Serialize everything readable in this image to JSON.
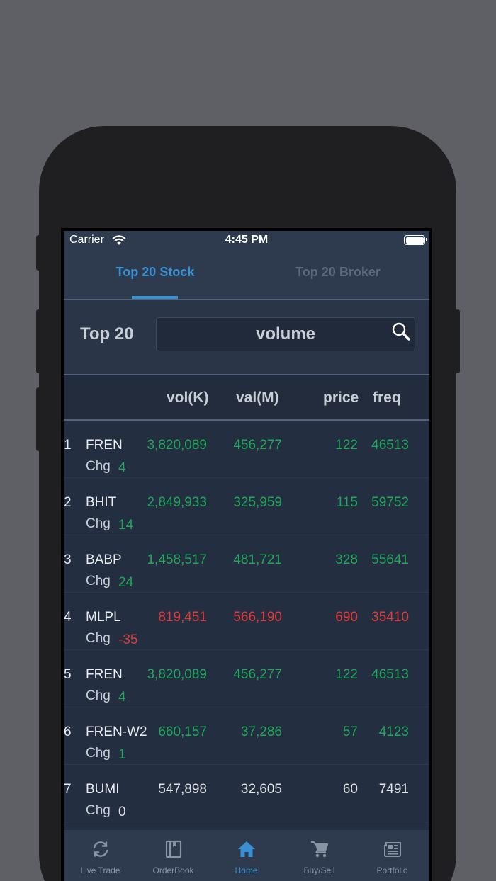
{
  "status_bar": {
    "carrier": "Carrier",
    "time": "4:45 PM"
  },
  "tabs": [
    {
      "label": "Top 20 Stock",
      "active": true
    },
    {
      "label": "Top 20 Broker",
      "active": false
    }
  ],
  "search": {
    "label": "Top 20",
    "value": "volume"
  },
  "table": {
    "headers": {
      "vol": "vol(K)",
      "val": "val(M)",
      "price": "price",
      "freq": "freq"
    },
    "chg_label": "Chg",
    "rows": [
      {
        "rank": "1",
        "code": "FREN",
        "vol": "3,820,089",
        "val": "456,277",
        "price": "122",
        "freq": "46513",
        "chg": "4",
        "trend": "up"
      },
      {
        "rank": "2",
        "code": "BHIT",
        "vol": "2,849,933",
        "val": "325,959",
        "price": "115",
        "freq": "59752",
        "chg": "14",
        "trend": "up"
      },
      {
        "rank": "3",
        "code": "BABP",
        "vol": "1,458,517",
        "val": "481,721",
        "price": "328",
        "freq": "55641",
        "chg": "24",
        "trend": "up"
      },
      {
        "rank": "4",
        "code": "MLPL",
        "vol": "819,451",
        "val": "566,190",
        "price": "690",
        "freq": "35410",
        "chg": "-35",
        "trend": "down"
      },
      {
        "rank": "5",
        "code": "FREN",
        "vol": "3,820,089",
        "val": "456,277",
        "price": "122",
        "freq": "46513",
        "chg": "4",
        "trend": "up"
      },
      {
        "rank": "6",
        "code": "FREN-W2",
        "vol": "660,157",
        "val": "37,286",
        "price": "57",
        "freq": "4123",
        "chg": "1",
        "trend": "up"
      },
      {
        "rank": "7",
        "code": "BUMI",
        "vol": "547,898",
        "val": "32,605",
        "price": "60",
        "freq": "7491",
        "chg": "0",
        "trend": "flat"
      }
    ]
  },
  "bottom_nav": [
    {
      "label": "Live Trade",
      "icon": "refresh-icon",
      "active": false
    },
    {
      "label": "OrderBook",
      "icon": "book-icon",
      "active": false
    },
    {
      "label": "Home",
      "icon": "home-icon",
      "active": true
    },
    {
      "label": "Buy/Sell",
      "icon": "cart-icon",
      "active": false
    },
    {
      "label": "Portfolio",
      "icon": "newspaper-icon",
      "active": false
    }
  ],
  "colors": {
    "accent": "#3a8fd1",
    "up": "#22a65a",
    "down": "#e03b3b",
    "background": "#232e40"
  }
}
